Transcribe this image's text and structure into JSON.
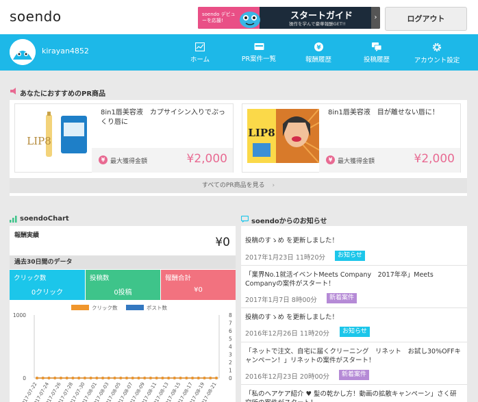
{
  "header": {
    "logo": "soendo",
    "banner": {
      "left_text": "soendo デビューを応援!",
      "title": "スタートガイド",
      "subtitle": "操作を学んで豪華報酬GET!!"
    },
    "logout_label": "ログアウト"
  },
  "nav": {
    "username": "kirayan4852",
    "items": [
      {
        "label": "ホーム",
        "icon": "chart-icon"
      },
      {
        "label": "PR案件一覧",
        "icon": "card-icon"
      },
      {
        "label": "報酬履歴",
        "icon": "yen-circle-icon"
      },
      {
        "label": "投稿履歴",
        "icon": "chat-icon"
      },
      {
        "label": "アカウント設定",
        "icon": "gear-icon"
      }
    ]
  },
  "recommended": {
    "title": "あなたにおすすめのPR商品",
    "cards": [
      {
        "title": "8in1唇美容液　カプサイシン入りでぷっくり唇に",
        "reward_label": "最大獲得金額",
        "price": "¥2,000",
        "img_text": "LIP8"
      },
      {
        "title": "8in1唇美容液　目が離せない唇に！",
        "reward_label": "最大獲得金額",
        "price": "¥2,000",
        "img_text": "LIP8"
      }
    ],
    "see_all": "すべてのPR商品を見る"
  },
  "chart_section": {
    "title": "soendoChart",
    "earnings_label": "報酬実績",
    "earnings_value": "¥0",
    "period_label": "過去30日間のデータ",
    "stats": [
      {
        "label": "クリック数",
        "value": "0クリック",
        "color": "#1cc6ea"
      },
      {
        "label": "投稿数",
        "value": "0投稿",
        "color": "#3ec48a"
      },
      {
        "label": "報酬合計",
        "value": "¥0",
        "color": "#f2727f"
      }
    ]
  },
  "chart_data": {
    "type": "line",
    "series": [
      {
        "name": "クリック数",
        "color": "#f0962c",
        "values": [
          0,
          0,
          0,
          0,
          0,
          0,
          0,
          0,
          0,
          0,
          0,
          0,
          0,
          0,
          0,
          0,
          0,
          0,
          0,
          0,
          0,
          0,
          0,
          0,
          0,
          0,
          0,
          0,
          0,
          0,
          0
        ]
      },
      {
        "name": "ポスト数",
        "color": "#3478c0",
        "values": [
          0,
          0,
          0,
          0,
          0,
          0,
          0,
          0,
          0,
          0,
          0,
          0,
          0,
          0,
          0,
          0,
          0,
          0,
          0,
          0,
          0,
          0,
          0,
          0,
          0,
          0,
          0,
          0,
          0,
          0,
          0
        ]
      }
    ],
    "x_labels": [
      "2017-07-22",
      "2017-07-24",
      "2017-07-26",
      "2017-07-28",
      "2017-07-30",
      "2017-08-01",
      "2017-08-03",
      "2017-08-05",
      "2017-08-07",
      "2017-08-09",
      "2017-08-11",
      "2017-08-13",
      "2017-08-15",
      "2017-08-17",
      "2017-08-19",
      "2017-08-21"
    ],
    "y_left_ticks": [
      "1000",
      "0"
    ],
    "y_right_ticks": [
      "8",
      "7",
      "6",
      "5",
      "4",
      "3",
      "2",
      "1",
      "0"
    ],
    "ylim_left": [
      0,
      1000
    ],
    "ylim_right": [
      0,
      8
    ]
  },
  "news": {
    "title": "soendoからのお知らせ",
    "items": [
      {
        "text": "投稿のすゝめ を更新しました！",
        "date": "2017年1月23日 11時20分",
        "badge": "お知らせ",
        "badge_color": "#1cc6ea"
      },
      {
        "text": "「業界No.1就活イベントMeets Company　2017年卒」Meets Companyの案件がスタート！",
        "date": "2017年1月7日 8時00分",
        "badge": "新着案件",
        "badge_color": "#b58ad6"
      },
      {
        "text": "投稿のすゝめ を更新しました！",
        "date": "2016年12月26日 11時20分",
        "badge": "お知らせ",
        "badge_color": "#1cc6ea"
      },
      {
        "text": "「ネットで注文、自宅に届くクリーニング　リネット　お試し30%OFFキャンペーン！」リネットの案件がスタート！",
        "date": "2016年12月23日 20時00分",
        "badge": "新着案件",
        "badge_color": "#b58ad6"
      },
      {
        "text": "「私のヘアケア紹介 ♥ 髪の乾かし方！動画の拡散キャンペーン」さく研究所の案件がスタート！",
        "date": "",
        "badge": "",
        "badge_color": ""
      }
    ]
  }
}
